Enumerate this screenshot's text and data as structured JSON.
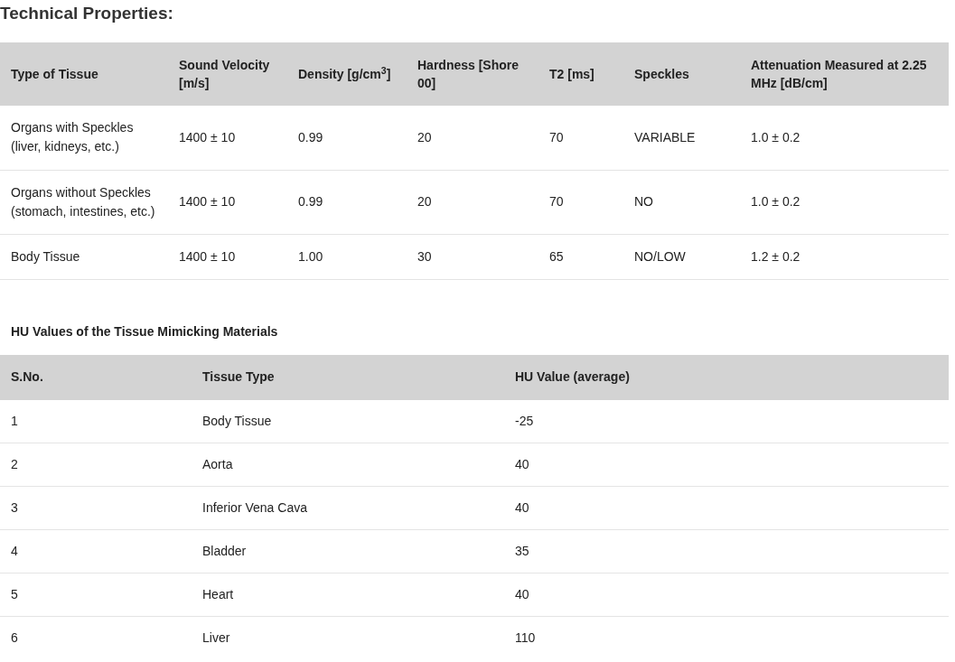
{
  "title": "Technical Properties:",
  "properties_table": {
    "columns": [
      "Type of Tissue",
      "Sound Velocity [m/s]",
      "Density [g/cm$^{3}$]",
      "Hardness [Shore 00]",
      "T2 [ms]",
      "Speckles",
      "Attenuation Measured at 2.25 MHz [dB/cm]"
    ],
    "rows": [
      [
        "Organs with Speckles (liver, kidneys, etc.)",
        "1400 ± 10",
        "0.99",
        "20",
        "70",
        "VARIABLE",
        "1.0 ± 0.2"
      ],
      [
        "Organs without Speckles (stomach, intestines, etc.)",
        "1400 ± 10",
        "0.99",
        "20",
        "70",
        "NO",
        "1.0 ± 0.2"
      ],
      [
        "Body Tissue",
        "1400 ± 10",
        "1.00",
        "30",
        "65",
        "NO/LOW",
        "1.2 ± 0.2"
      ]
    ]
  },
  "hu_section": {
    "title": "HU Values of the Tissue Mimicking Materials",
    "table": {
      "columns": [
        "S.No.",
        "Tissue Type",
        "HU Value (average)"
      ],
      "rows": [
        [
          "1",
          "Body Tissue",
          "-25"
        ],
        [
          "2",
          "Aorta",
          "40"
        ],
        [
          "3",
          "Inferior Vena Cava",
          "40"
        ],
        [
          "4",
          "Bladder",
          "35"
        ],
        [
          "5",
          "Heart",
          "40"
        ],
        [
          "6",
          "Liver",
          "110"
        ]
      ]
    }
  }
}
